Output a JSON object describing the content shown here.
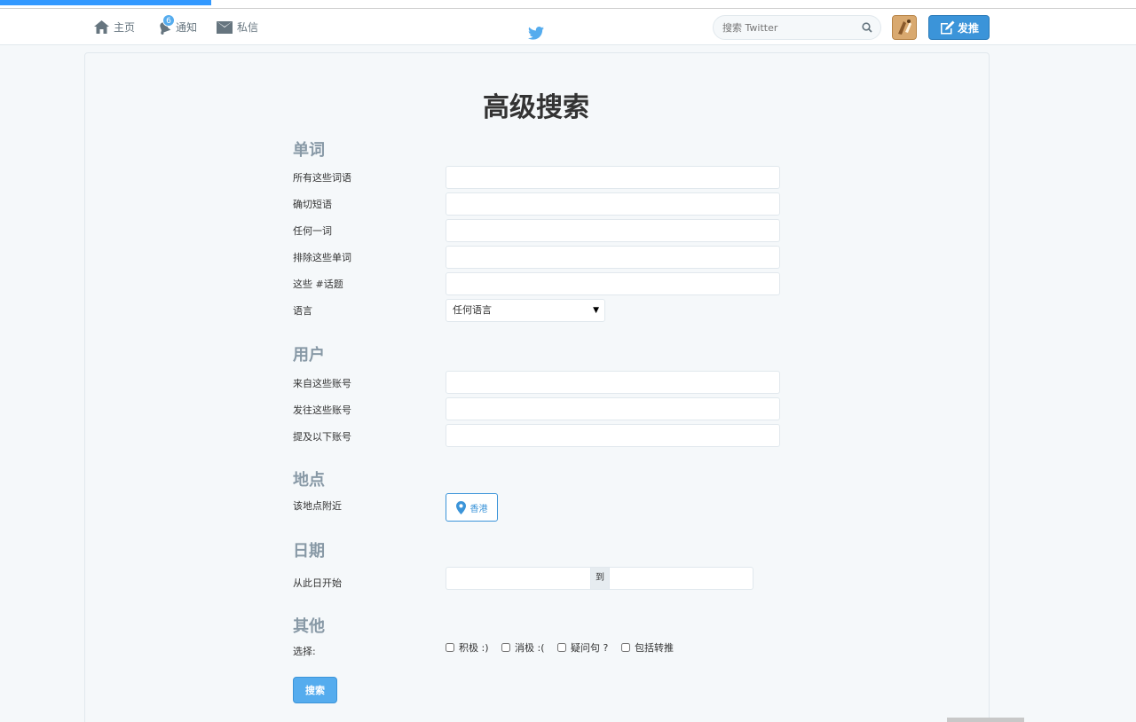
{
  "nav": {
    "home": "主页",
    "notifications": "通知",
    "notifications_count": "6",
    "messages": "私信",
    "search_placeholder": "搜索 Twitter",
    "tweet_button": "发推"
  },
  "page_title": "高级搜索",
  "words": {
    "title": "单词",
    "all_words": "所有这些词语",
    "exact_phrase": "确切短语",
    "any_words": "任何一词",
    "none_words": "排除这些单词",
    "hashtags": "这些 #话题",
    "language": "语言",
    "language_value": "任何语言"
  },
  "people": {
    "title": "用户",
    "from": "来自这些账号",
    "to": "发往这些账号",
    "mentioning": "提及以下账号"
  },
  "places": {
    "title": "地点",
    "near": "该地点附近",
    "place_value": "香港"
  },
  "dates": {
    "title": "日期",
    "since": "从此日开始",
    "to": "到"
  },
  "other": {
    "title": "其他",
    "select": "选择:",
    "positive": "积极 :)",
    "negative": "消极 :(",
    "question": "疑问句 ?",
    "retweets": "包括转推"
  },
  "submit": "搜索",
  "colors": {
    "accent": "#55acee",
    "accent_dark": "#3b94d9",
    "section_title": "#8899a6",
    "background": "#f5f8fa"
  },
  "icons": [
    "home-icon",
    "bell-icon",
    "envelope-icon",
    "twitter-bird-icon",
    "search-icon",
    "compose-icon",
    "map-pin-icon"
  ]
}
